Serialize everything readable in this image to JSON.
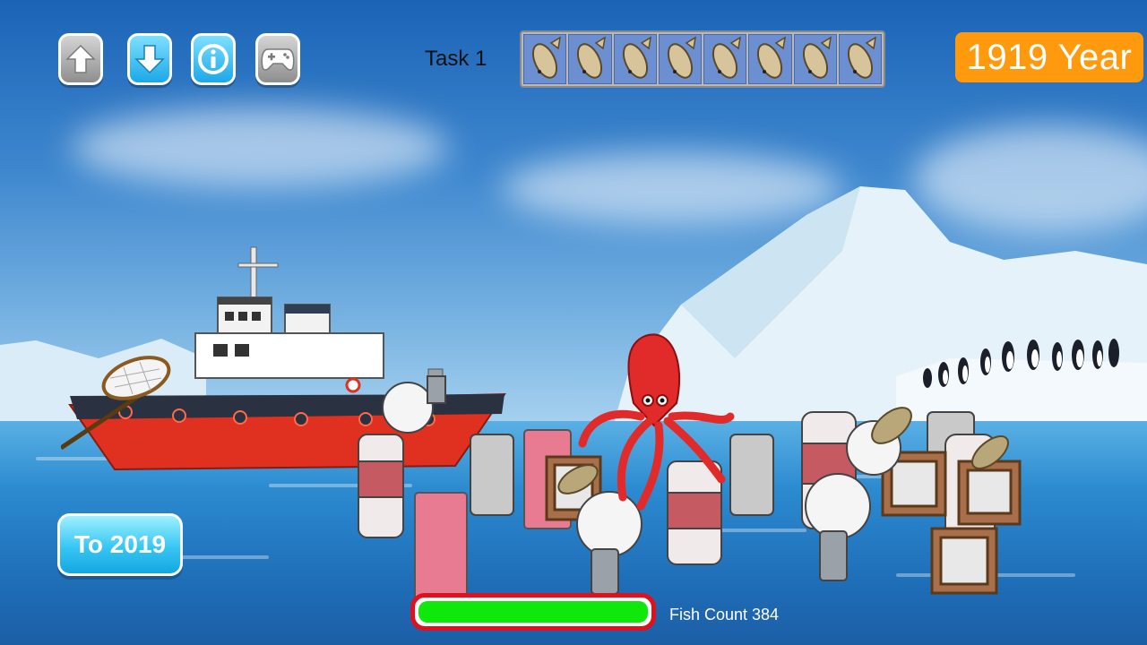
{
  "hud": {
    "buttons": [
      {
        "name": "up-arrow-button",
        "icon": "arrow-up-icon",
        "style": "grey"
      },
      {
        "name": "down-arrow-button",
        "icon": "arrow-down-icon",
        "style": "blue"
      },
      {
        "name": "info-button",
        "icon": "info-icon",
        "style": "blue"
      },
      {
        "name": "gamepad-button",
        "icon": "gamepad-icon",
        "style": "grey"
      }
    ],
    "task_label": "Task 1",
    "fish_slots": 8,
    "year_label": "1919 Year"
  },
  "controls": {
    "to_button_label": "To 2019"
  },
  "status": {
    "progress": 1.0,
    "fish_count_label": "Fish Count 384"
  },
  "colors": {
    "year_badge": "#ff9a0e",
    "progress_fill": "#0ee80a",
    "progress_border": "#e0101c",
    "boat_hull": "#e03020"
  }
}
